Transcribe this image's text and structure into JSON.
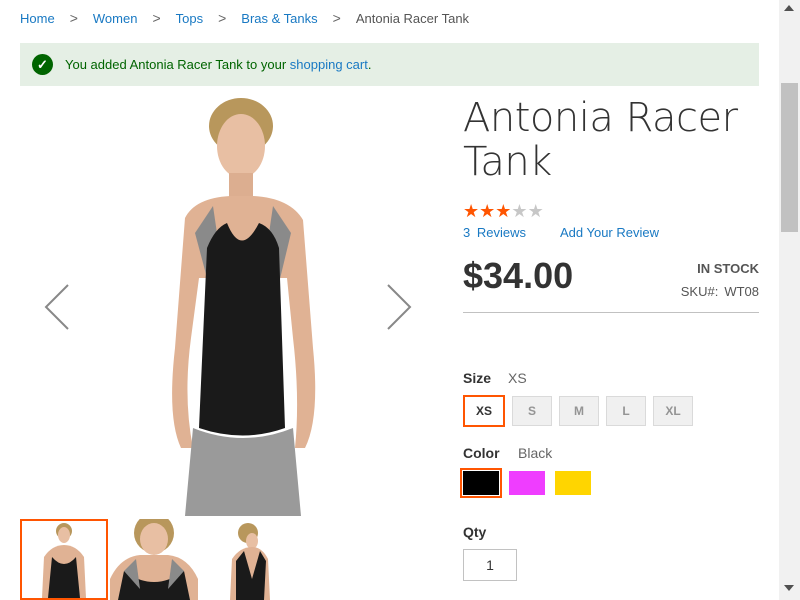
{
  "breadcrumbs": {
    "items": [
      "Home",
      "Women",
      "Tops",
      "Bras & Tanks"
    ],
    "current": "Antonia Racer Tank",
    "separator": ">"
  },
  "message": {
    "text_before": "You added Antonia Racer Tank to your ",
    "link": "shopping cart",
    "text_after": ".",
    "icon": "check-icon"
  },
  "product": {
    "name": "Antonia Racer Tank",
    "rating": {
      "filled": 3,
      "total": 5
    },
    "reviews_count": "3",
    "reviews_label": "Reviews",
    "add_review": "Add Your Review",
    "price": "$34.00",
    "stock": "In stock",
    "sku_label": "SKU#:",
    "sku": "WT08"
  },
  "size": {
    "label": "Size",
    "selected": "XS",
    "options": [
      "XS",
      "S",
      "M",
      "L",
      "XL"
    ]
  },
  "color": {
    "label": "Color",
    "selected": "Black",
    "options": [
      {
        "name": "Black",
        "hex": "#000000"
      },
      {
        "name": "Purple",
        "hex": "#ef3dff"
      },
      {
        "name": "Yellow",
        "hex": "#ffd500"
      }
    ]
  },
  "qty": {
    "label": "Qty",
    "value": "1"
  },
  "colors": {
    "accent": "#ff5501",
    "link": "#1979c3",
    "success_bg": "#e5efe5",
    "success_text": "#006400"
  }
}
